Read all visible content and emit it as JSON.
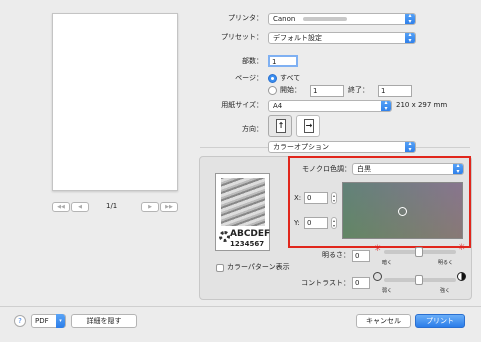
{
  "printer": {
    "label": "プリンタ：",
    "value": "Canon"
  },
  "preset": {
    "label": "プリセット：",
    "value": "デフォルト設定"
  },
  "copies": {
    "label": "部数：",
    "value": "1"
  },
  "pages": {
    "label": "ページ：",
    "all_label": "すべて",
    "from_label": "開始：",
    "from_value": "1",
    "to_label": "終了：",
    "to_value": "1"
  },
  "paper": {
    "label": "用紙サイズ：",
    "value": "A4",
    "dims": "210 x 297 mm"
  },
  "orientation": {
    "label": "方向："
  },
  "section": {
    "value": "カラーオプション"
  },
  "preview": {
    "page_indicator": "1/1",
    "first": "◀◀",
    "prev": "◀",
    "next": "▶",
    "last": "▶▶"
  },
  "mono": {
    "label": "モノクロ色調：",
    "value": "白黒"
  },
  "x": {
    "label": "X:",
    "value": "0"
  },
  "y": {
    "label": "Y:",
    "value": "0"
  },
  "sample": {
    "line1": "ABCDEF",
    "line2": "1234567"
  },
  "brightness": {
    "label": "明るさ：",
    "value": "0",
    "low": "暗く",
    "high": "明るく"
  },
  "contrast": {
    "label": "コントラスト：",
    "value": "0",
    "low": "弱く",
    "high": "強く"
  },
  "pattern": {
    "label": "カラーパターン表示"
  },
  "footer": {
    "help": "?",
    "pdf": "PDF",
    "hide_details": "詳細を隠す",
    "cancel": "キャンセル",
    "print": "プリント"
  },
  "colors": {
    "accent": "#2b7de9",
    "highlight": "#e1261c"
  }
}
